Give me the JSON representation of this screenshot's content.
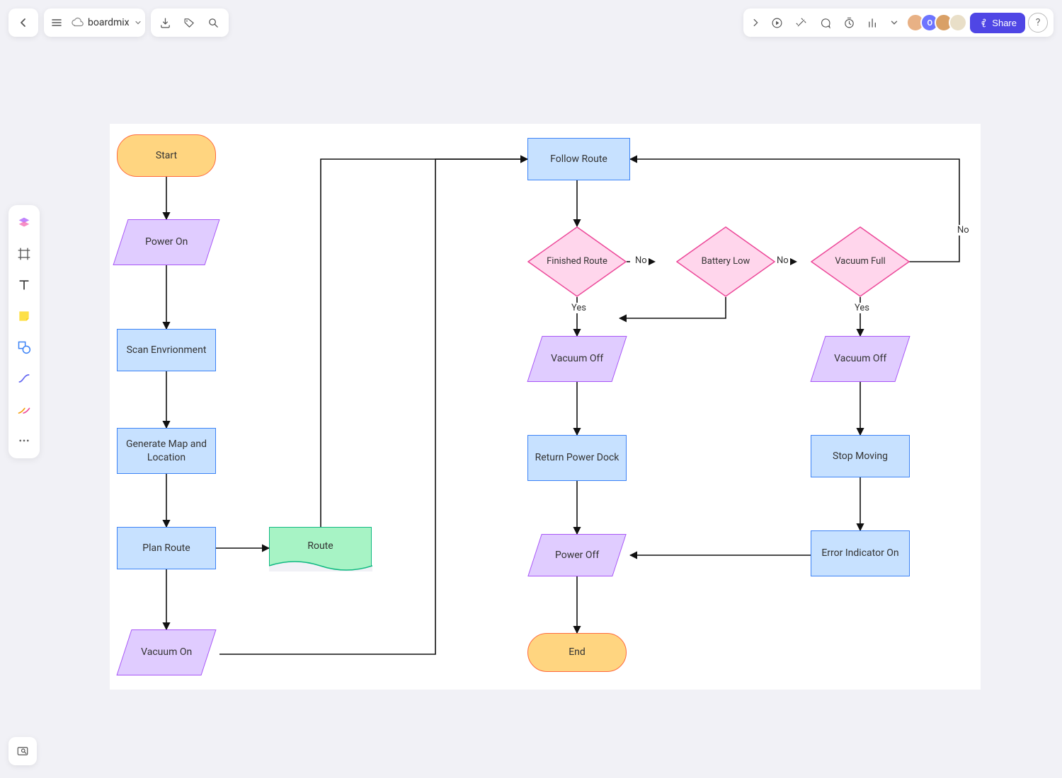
{
  "app": {
    "name": "boardmix"
  },
  "toolbar": {
    "share_label": "Share"
  },
  "nodes": {
    "start": "Start",
    "power_on": "Power On",
    "scan_env": "Scan Envrionment",
    "gen_map": "Generate Map and Location",
    "plan_route": "Plan Route",
    "route": "Route",
    "vacuum_on": "Vacuum On",
    "follow_route": "Follow Route",
    "finished_route": "Finished Route",
    "battery_low": "Battery Low",
    "vacuum_full": "Vacuum Full",
    "vacuum_off_1": "Vacuum Off",
    "vacuum_off_2": "Vacuum Off",
    "return_dock": "Return Power Dock",
    "stop_moving": "Stop Moving",
    "error_ind": "Error Indicator On",
    "power_off": "Power Off",
    "end": "End"
  },
  "edges": {
    "yes": "Yes",
    "no": "No"
  }
}
